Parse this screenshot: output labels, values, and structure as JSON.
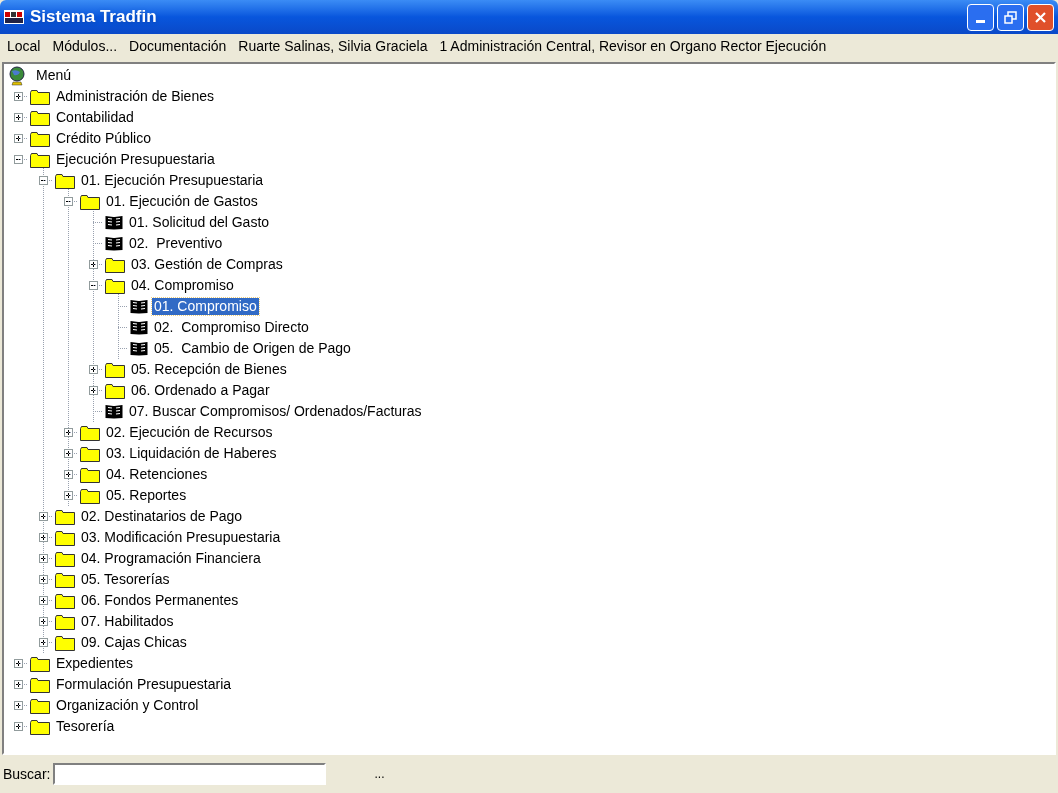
{
  "window": {
    "title": "Sistema Tradfin"
  },
  "menu_bar": [
    "Local",
    "Módulos...",
    "Documentación",
    "Ruarte Salinas, Silvia Graciela",
    "1 Administración Central, Revisor en Organo Rector Ejecución"
  ],
  "tree": {
    "label": "Menú",
    "selected": false,
    "children": [
      {
        "kind": "folder",
        "label": "Administración de Bienes",
        "expanded": false,
        "selected": false
      },
      {
        "kind": "folder",
        "label": "Contabilidad",
        "expanded": false,
        "selected": false
      },
      {
        "kind": "folder",
        "label": "Crédito Público",
        "expanded": false,
        "selected": false
      },
      {
        "kind": "folder",
        "label": "Ejecución Presupuestaria",
        "expanded": true,
        "selected": false,
        "children": [
          {
            "kind": "folder",
            "label": "01. Ejecución Presupuestaria",
            "expanded": true,
            "selected": false,
            "children": [
              {
                "kind": "folder",
                "label": "01. Ejecución de Gastos",
                "expanded": true,
                "selected": false,
                "children": [
                  {
                    "kind": "leaf",
                    "label": "01. Solicitud del Gasto",
                    "selected": false
                  },
                  {
                    "kind": "leaf",
                    "label": "02.  Preventivo",
                    "selected": false
                  },
                  {
                    "kind": "folder",
                    "label": "03. Gestión de Compras",
                    "expanded": false,
                    "selected": false
                  },
                  {
                    "kind": "folder",
                    "label": "04. Compromiso",
                    "expanded": true,
                    "selected": false,
                    "children": [
                      {
                        "kind": "leaf",
                        "label": "01. Compromiso",
                        "selected": true
                      },
                      {
                        "kind": "leaf",
                        "label": "02.  Compromiso Directo",
                        "selected": false
                      },
                      {
                        "kind": "leaf",
                        "label": "05.  Cambio de Origen de Pago",
                        "selected": false
                      }
                    ]
                  },
                  {
                    "kind": "folder",
                    "label": "05. Recepción de Bienes",
                    "expanded": false,
                    "selected": false
                  },
                  {
                    "kind": "folder",
                    "label": "06. Ordenado a Pagar",
                    "expanded": false,
                    "selected": false
                  },
                  {
                    "kind": "leaf",
                    "label": "07. Buscar Compromisos/ Ordenados/Facturas",
                    "selected": false
                  }
                ]
              },
              {
                "kind": "folder",
                "label": "02. Ejecución de Recursos",
                "expanded": false,
                "selected": false
              },
              {
                "kind": "folder",
                "label": "03. Liquidación de Haberes",
                "expanded": false,
                "selected": false
              },
              {
                "kind": "folder",
                "label": "04. Retenciones",
                "expanded": false,
                "selected": false
              },
              {
                "kind": "folder",
                "label": "05. Reportes",
                "expanded": false,
                "selected": false
              }
            ]
          },
          {
            "kind": "folder",
            "label": "02. Destinatarios de Pago",
            "expanded": false,
            "selected": false
          },
          {
            "kind": "folder",
            "label": "03. Modificación Presupuestaria",
            "expanded": false,
            "selected": false
          },
          {
            "kind": "folder",
            "label": "04. Programación Financiera",
            "expanded": false,
            "selected": false
          },
          {
            "kind": "folder",
            "label": "05. Tesorerías",
            "expanded": false,
            "selected": false
          },
          {
            "kind": "folder",
            "label": "06. Fondos Permanentes",
            "expanded": false,
            "selected": false
          },
          {
            "kind": "folder",
            "label": "07. Habilitados",
            "expanded": false,
            "selected": false
          },
          {
            "kind": "folder",
            "label": "09. Cajas Chicas",
            "expanded": false,
            "selected": false
          }
        ]
      },
      {
        "kind": "folder",
        "label": "Expedientes",
        "expanded": false,
        "selected": false
      },
      {
        "kind": "folder",
        "label": "Formulación Presupuestaria",
        "expanded": false,
        "selected": false
      },
      {
        "kind": "folder",
        "label": "Organización y Control",
        "expanded": false,
        "selected": false
      },
      {
        "kind": "folder",
        "label": "Tesorería",
        "expanded": false,
        "selected": false
      }
    ]
  },
  "search": {
    "label": "Buscar:"
  },
  "browse_button": "..."
}
